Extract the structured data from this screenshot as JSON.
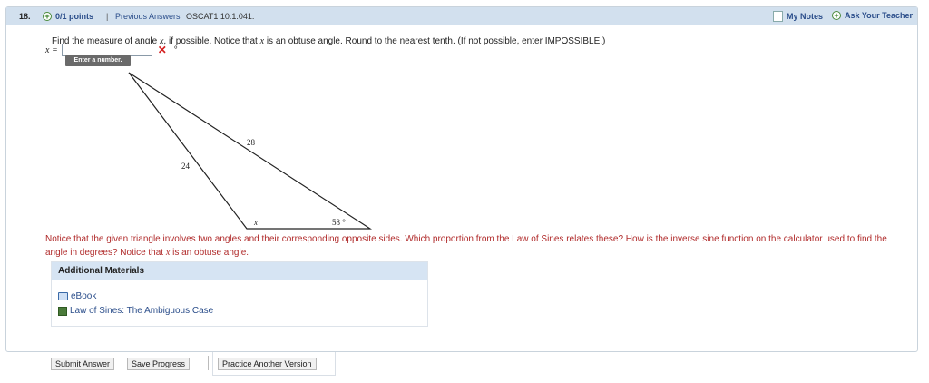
{
  "header": {
    "question_number": "18.",
    "points": "0/1 points",
    "separator": "|",
    "previous_answers": "Previous Answers",
    "reference": "OSCAT1 10.1.041.",
    "my_notes": "My Notes",
    "ask_teacher": "Ask Your Teacher"
  },
  "question": {
    "prompt_pre": "Find the measure of angle ",
    "prompt_var": "x",
    "prompt_mid": ", if possible. Notice that ",
    "prompt_var2": "x",
    "prompt_post": " is an obtuse angle. Round to the nearest tenth. (If not possible, enter IMPOSSIBLE.)",
    "answer_label": "x =",
    "answer_value": "",
    "degree": "°",
    "tooltip": "Enter a number."
  },
  "figure": {
    "side_top": "28",
    "side_left": "24",
    "angle_x": "x",
    "angle_58": "58 °"
  },
  "hint": {
    "text_pre": "Notice that the given triangle involves two angles and their corresponding opposite sides. Which proportion from the Law of Sines relates these? How is the inverse sine function on the calculator used to find the angle in degrees? Notice that ",
    "text_var": "x",
    "text_post": " is an obtuse angle."
  },
  "materials": {
    "title": "Additional Materials",
    "items": [
      {
        "label": "eBook",
        "icon": "book-icon"
      },
      {
        "label": "Law of Sines: The Ambiguous Case",
        "icon": "film-icon"
      }
    ]
  },
  "buttons": {
    "submit": "Submit Answer",
    "save": "Save Progress",
    "practice": "Practice Another Version"
  },
  "colors": {
    "header_bg": "#d2e0ee",
    "link": "#2a4d8a",
    "hint": "#b02a2a",
    "wrong": "#d42020"
  }
}
